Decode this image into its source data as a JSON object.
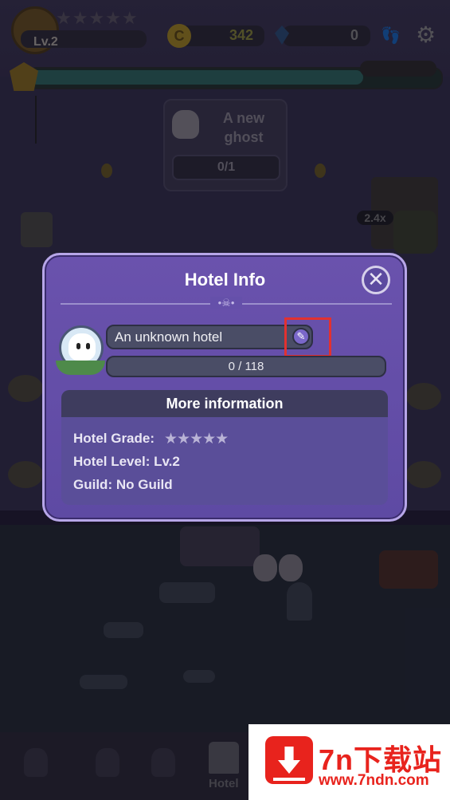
{
  "hud": {
    "level": "Lv.2",
    "grade_stars": "★★★★★",
    "coins": "342",
    "gems": "0",
    "xp_fraction": 0.82
  },
  "quest": {
    "title": "A new ghost",
    "progress": "0/1"
  },
  "boost": {
    "multiplier": "2.4x"
  },
  "modal": {
    "title": "Hotel Info",
    "close_symbol": "✕",
    "hotel_name": "An unknown hotel",
    "edit_symbol": "✎",
    "progress": "0 / 118",
    "more_info_header": "More information",
    "grade_label": "Hotel Grade:",
    "grade_stars": "★★★★★",
    "level_label": "Hotel Level:",
    "level_value": "Lv.2",
    "guild_label": "Guild:",
    "guild_value": "No Guild"
  },
  "bottom_nav": {
    "hotel_label": "Hotel"
  },
  "watermark": {
    "title": "7n下载站",
    "url": "www.7ndn.com"
  },
  "colors": {
    "modal_bg": "#6a52ad",
    "highlight": "#e23130",
    "watermark": "#e8231d"
  }
}
